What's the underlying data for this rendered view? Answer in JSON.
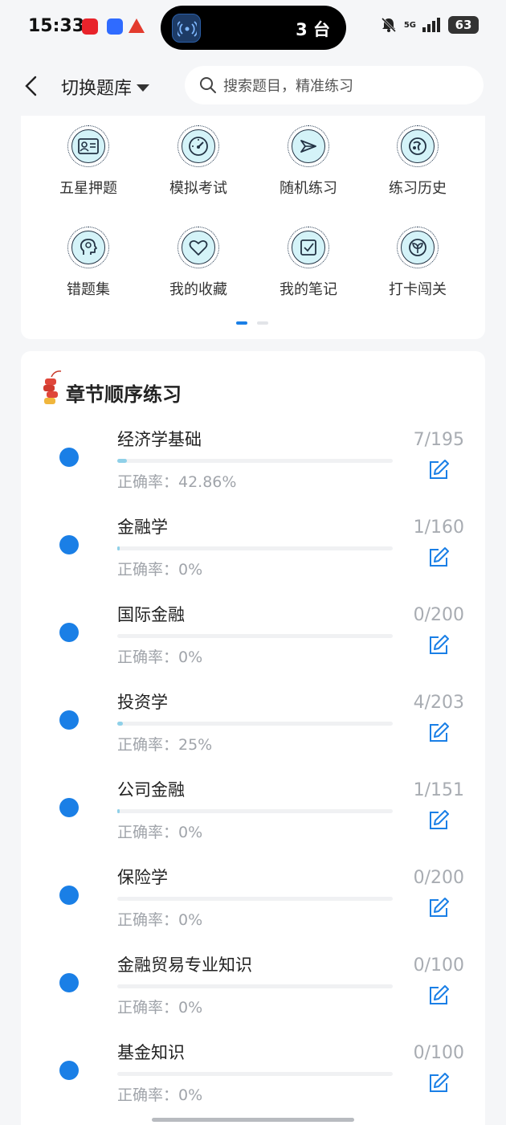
{
  "status": {
    "time": "15:33",
    "island_badge": "3",
    "island_count": "3 台",
    "network": "5G",
    "battery": "63"
  },
  "header": {
    "title": "切换题库",
    "search_placeholder": "搜索题目，精准练习"
  },
  "grid": [
    {
      "label": "五星押题",
      "icon": "id-card-icon"
    },
    {
      "label": "模拟考试",
      "icon": "gauge-icon"
    },
    {
      "label": "随机练习",
      "icon": "shuffle-icon"
    },
    {
      "label": "练习历史",
      "icon": "history-icon"
    },
    {
      "label": "错题集",
      "icon": "head-icon"
    },
    {
      "label": "我的收藏",
      "icon": "heart-icon"
    },
    {
      "label": "我的笔记",
      "icon": "note-icon"
    },
    {
      "label": "打卡闯关",
      "icon": "sprout-icon"
    }
  ],
  "chapters_section": {
    "title": "章节顺序练习"
  },
  "chapters": [
    {
      "name": "经济学基础",
      "accuracy": "正确率：42.86%",
      "count": "7/195",
      "progress": 0.036
    },
    {
      "name": "金融学",
      "accuracy": "正确率：0%",
      "count": "1/160",
      "progress": 0.006
    },
    {
      "name": "国际金融",
      "accuracy": "正确率：0%",
      "count": "0/200",
      "progress": 0
    },
    {
      "name": "投资学",
      "accuracy": "正确率：25%",
      "count": "4/203",
      "progress": 0.02
    },
    {
      "name": "公司金融",
      "accuracy": "正确率：0%",
      "count": "1/151",
      "progress": 0.007
    },
    {
      "name": "保险学",
      "accuracy": "正确率：0%",
      "count": "0/200",
      "progress": 0
    },
    {
      "name": "金融贸易专业知识",
      "accuracy": "正确率：0%",
      "count": "0/100",
      "progress": 0
    },
    {
      "name": "基金知识",
      "accuracy": "正确率：0%",
      "count": "0/100",
      "progress": 0
    }
  ],
  "colors": {
    "accent": "#1a7fe6",
    "icon_fill": "#d4f3f8",
    "progress": "#8fd0e8"
  }
}
